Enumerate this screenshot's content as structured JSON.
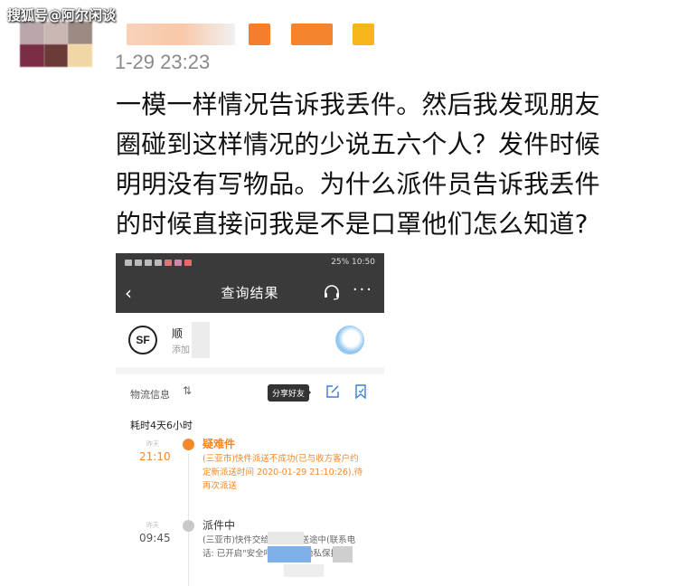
{
  "watermark": "搜狐号@阿尔闲谈",
  "post": {
    "time": "1-29 23:23",
    "lines": [
      "一模一样情况告诉我丢件。然后我发现朋友",
      "圈碰到这样情况的少说五六个人？发件时候",
      "明明没有写物品。为什么派件员告诉我丢件",
      "的时候直接问我是不是口罩他们怎么知道?"
    ]
  },
  "colors": {
    "accent_orange": "#f5882a",
    "status_bar": "#3a3a3a",
    "muted_gray": "#9e9e9e"
  },
  "phone": {
    "status_left": "",
    "status_right": "25% 10:50",
    "title": "查询结果",
    "back_icon": "back-chevron-icon",
    "headset_icon": "headset-icon",
    "more_icon": "more-dots-icon",
    "carrier": {
      "logo": "SF",
      "name": "顺",
      "subtitle": "添加"
    },
    "logistics": {
      "label": "物流信息",
      "tooltip": "分享好友",
      "elapsed": "耗时4天6小时"
    },
    "events": [
      {
        "date": "昨天",
        "time": "21:10",
        "status": "疑难件",
        "detail": "(三亚市)快件派送不成功(已与收方客户约定新派送时间 2020-01-29 21:10:26),待再次派送"
      },
      {
        "date": "昨天",
        "time": "09:45",
        "status": "派件中",
        "detail": "(三亚市)快件交给      ,正在派送途中(联系电话:              已开启\"安全呼叫\"       电话隐私保护...)"
      }
    ]
  }
}
